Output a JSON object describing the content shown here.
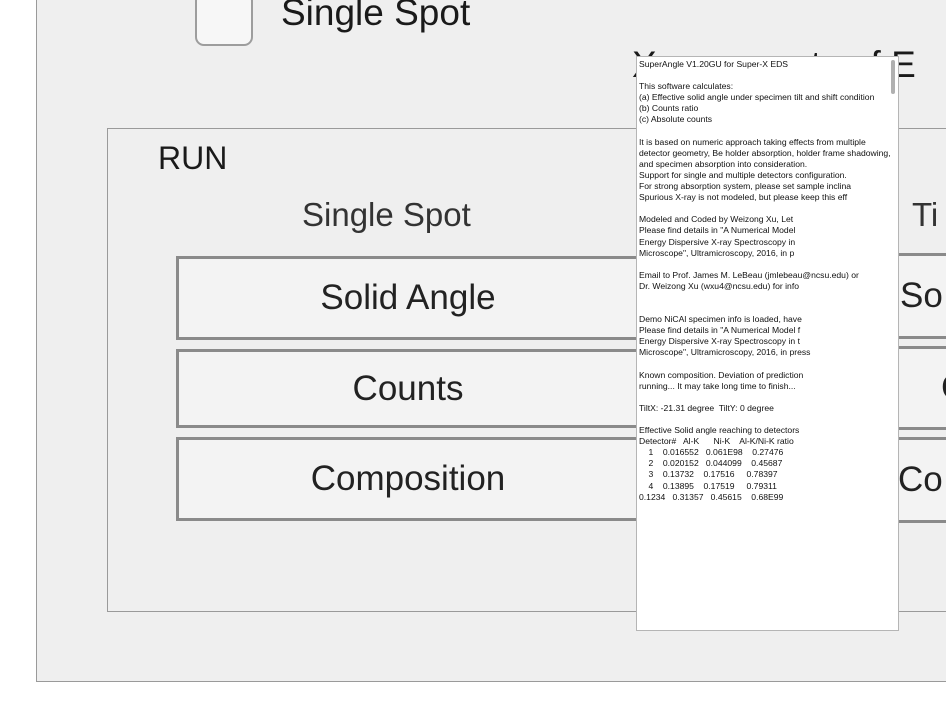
{
  "options": {
    "single_spot_checkbox_label": "Single Spot",
    "single_spot_checked": false
  },
  "background": {
    "partial_title": "X-ray counts of E"
  },
  "run_panel": {
    "title": "RUN",
    "single_spot": {
      "heading": "Single Spot",
      "solid_angle": "Solid Angle",
      "counts": "Counts",
      "composition": "Composition"
    },
    "tilt": {
      "heading": "Ti",
      "solid_angle": "So",
      "counts": "C",
      "composition": "Co"
    }
  },
  "info_popup": {
    "lines": [
      "SuperAngle V1.20GU for Super-X EDS",
      "",
      "This software calculates:",
      "(a) Effective solid angle under specimen tilt and shift condition",
      "(b) Counts ratio",
      "(c) Absolute counts",
      "",
      "It is based on numeric approach taking effects from multiple",
      "detector geometry, Be holder absorption, holder frame shadowing,",
      "and specimen absorption into consideration.",
      "Support for single and multiple detectors configuration.",
      "For strong absorption system, please set sample inclina",
      "Spurious X-ray is not modeled, but please keep this eff",
      "",
      "Modeled and Coded by Weizong Xu, Let",
      "Please find details in \"A Numerical Model",
      "Energy Dispersive X-ray Spectroscopy in",
      "Microscope\", Ultramicroscopy, 2016, in p",
      "",
      "Email to Prof. James M. LeBeau (jmlebeau@ncsu.edu) or",
      "Dr. Weizong Xu (wxu4@ncsu.edu) for info",
      "",
      "",
      "Demo NiCAl specimen info is loaded, have",
      "Please find details in \"A Numerical Model f",
      "Energy Dispersive X-ray Spectroscopy in t",
      "Microscope\", Ultramicroscopy, 2016, in press",
      "",
      "Known composition. Deviation of prediction",
      "running... It may take long time to finish...",
      "",
      "TiltX: -21.31 degree  TiltY: 0 degree",
      "",
      "Effective Solid angle reaching to detectors",
      "Detector#   Al-K      Ni-K    Al-K/Ni-K ratio",
      "    1    0.016552   0.061E98    0.27476",
      "    2    0.020152   0.044099    0.45687",
      "    3    0.13732    0.17516     0.78397",
      "    4    0.13895    0.17519     0.79311",
      "0.1234   0.31357   0.45615    0.68E99"
    ]
  }
}
